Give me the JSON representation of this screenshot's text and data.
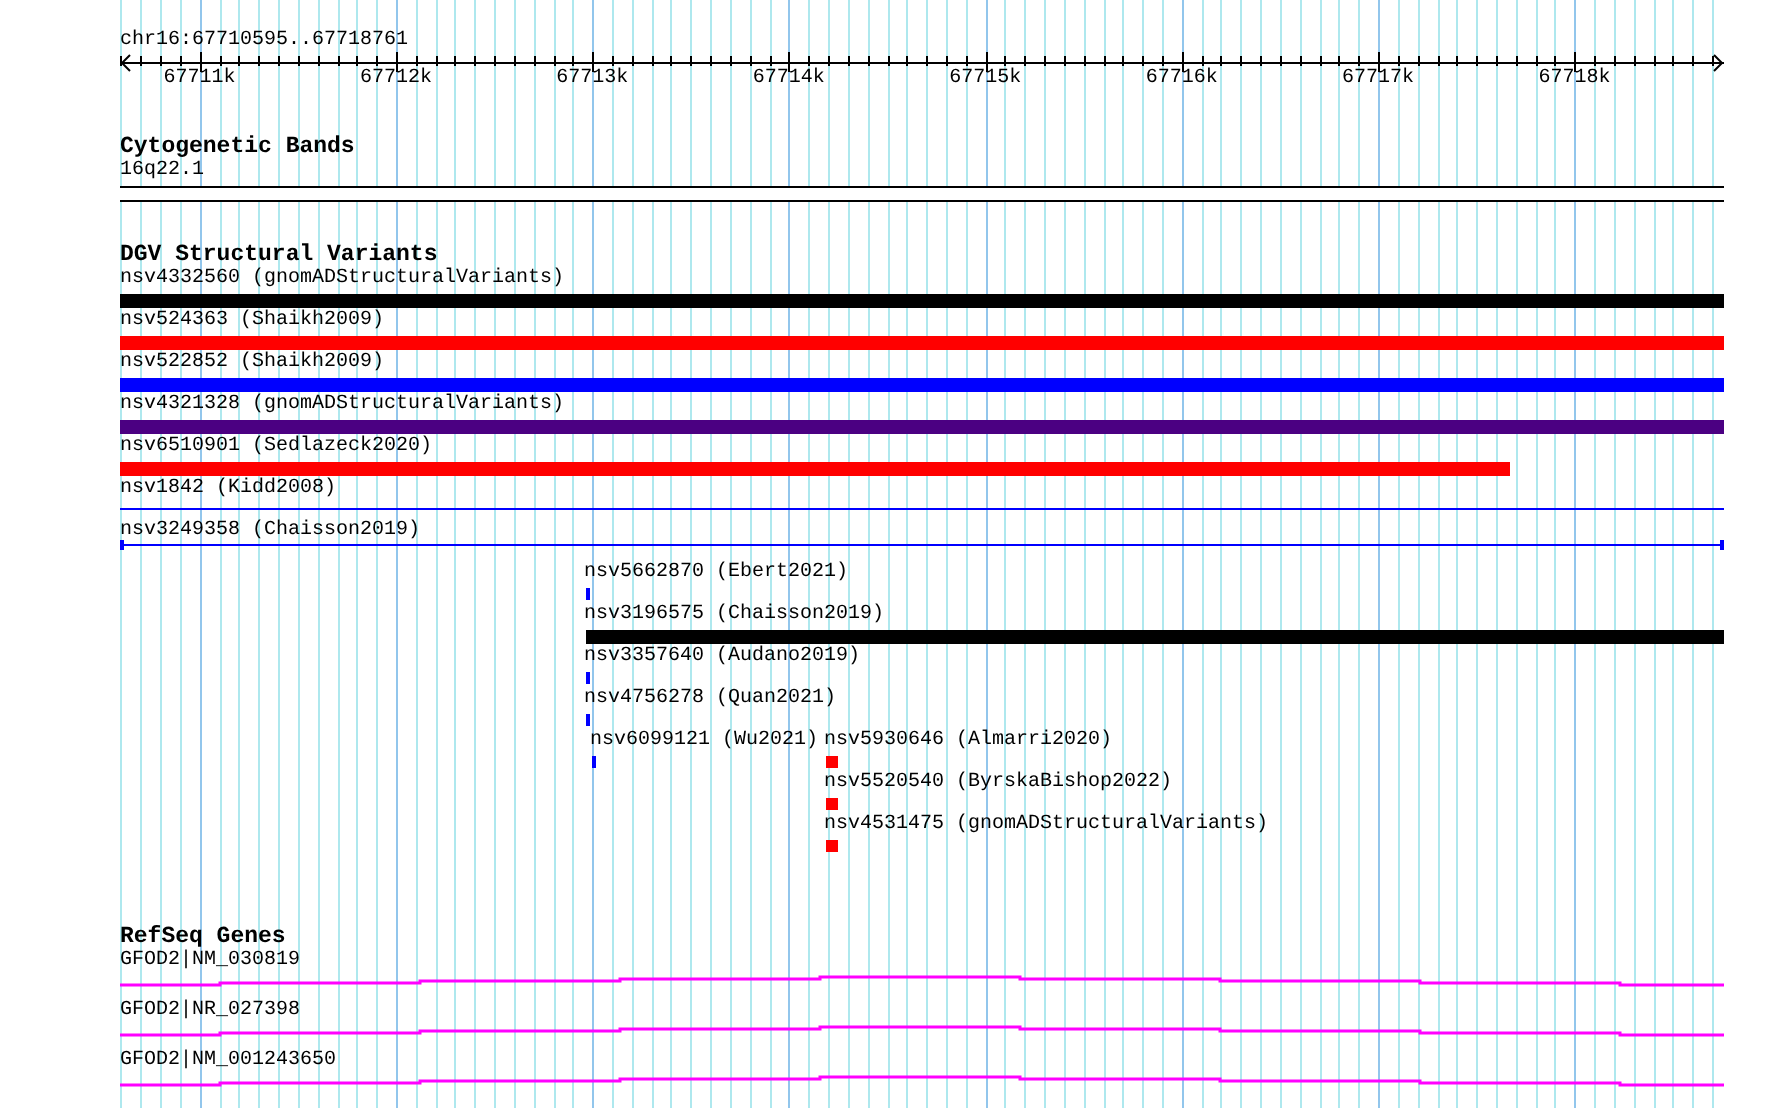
{
  "ruler": {
    "location": "chr16:67710595..67718761",
    "ticks": [
      "67711k",
      "67712k",
      "67713k",
      "67714k",
      "67715k",
      "67716k",
      "67717k",
      "67718k"
    ]
  },
  "cytogenetic_bands": {
    "title": "Cytogenetic Bands",
    "bands": [
      {
        "label": "16q22.1"
      }
    ]
  },
  "dgv_structural_variants": {
    "title": "DGV Structural Variants",
    "features": [
      {
        "label": "nsv4332560 (gnomADStructuralVariants)",
        "kind": "bar",
        "color": "#000000"
      },
      {
        "label": "nsv524363 (Shaikh2009)",
        "kind": "bar",
        "color": "#ff0000"
      },
      {
        "label": "nsv522852 (Shaikh2009)",
        "kind": "bar",
        "color": "#0000ff"
      },
      {
        "label": "nsv4321328 (gnomADStructuralVariants)",
        "kind": "bar",
        "color": "#4b0082"
      },
      {
        "label": "nsv6510901 (Sedlazeck2020)",
        "kind": "bar",
        "color": "#ff0000"
      },
      {
        "label": "nsv1842 (Kidd2008)",
        "kind": "line",
        "color": "#0000ff"
      },
      {
        "label": "nsv3249358 (Chaisson2019)",
        "kind": "capped-line",
        "color": "#0000ff"
      },
      {
        "label": "nsv5662870 (Ebert2021)",
        "kind": "mark",
        "color": "#0000ff"
      },
      {
        "label": "nsv3196575 (Chaisson2019)",
        "kind": "bar",
        "color": "#000000"
      },
      {
        "label": "nsv3357640 (Audano2019)",
        "kind": "mark",
        "color": "#0000ff"
      },
      {
        "label": "nsv4756278 (Quan2021)",
        "kind": "mark",
        "color": "#0000ff"
      },
      {
        "label": "nsv6099121 (Wu2021)",
        "kind": "mark",
        "color": "#0000ff"
      },
      {
        "label": "nsv5930646 (Almarri2020)",
        "kind": "mark",
        "color": "#ff0000"
      },
      {
        "label": "nsv5520540 (ByrskaBishop2022)",
        "kind": "mark",
        "color": "#ff0000"
      },
      {
        "label": "nsv4531475 (gnomADStructuralVariants)",
        "kind": "mark",
        "color": "#ff0000"
      }
    ]
  },
  "refseq_genes": {
    "title": "RefSeq Genes",
    "genes": [
      {
        "label": "GFOD2|NM_030819"
      },
      {
        "label": "GFOD2|NR_027398"
      },
      {
        "label": "GFOD2|NM_001243650"
      }
    ]
  }
}
